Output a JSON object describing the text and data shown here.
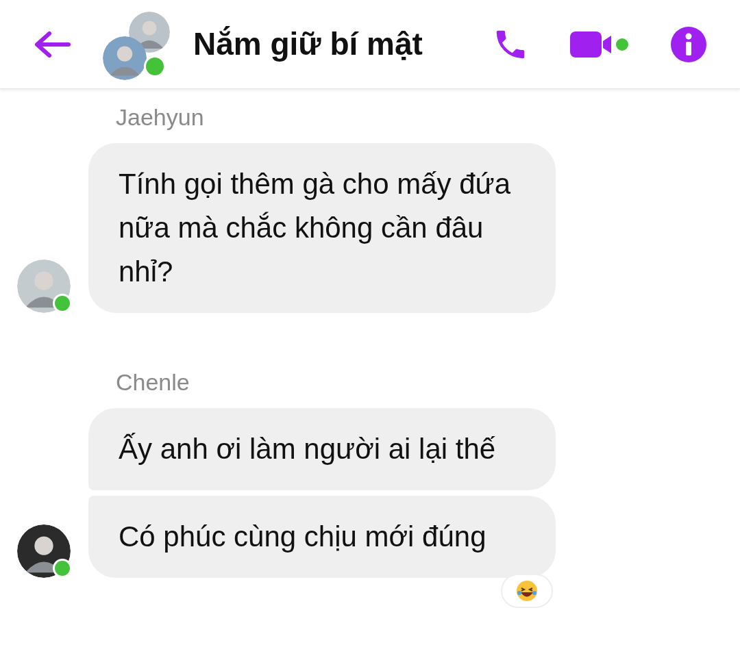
{
  "header": {
    "title": "Nắm giữ bí mật",
    "online": true,
    "video_active": true
  },
  "groups": [
    {
      "sender": "Jaehyun",
      "online": true,
      "bubbles": [
        {
          "text": "Tính gọi thêm gà cho mấy đứa nữa mà chắc không cần đâu nhỉ?",
          "reacted": false
        }
      ]
    },
    {
      "sender": "Chenle",
      "online": true,
      "bubbles": [
        {
          "text": "Ấy anh ơi làm người ai lại thế",
          "reacted": false
        },
        {
          "text": "Có phúc cùng chịu mới đúng",
          "reacted": true
        }
      ]
    }
  ]
}
